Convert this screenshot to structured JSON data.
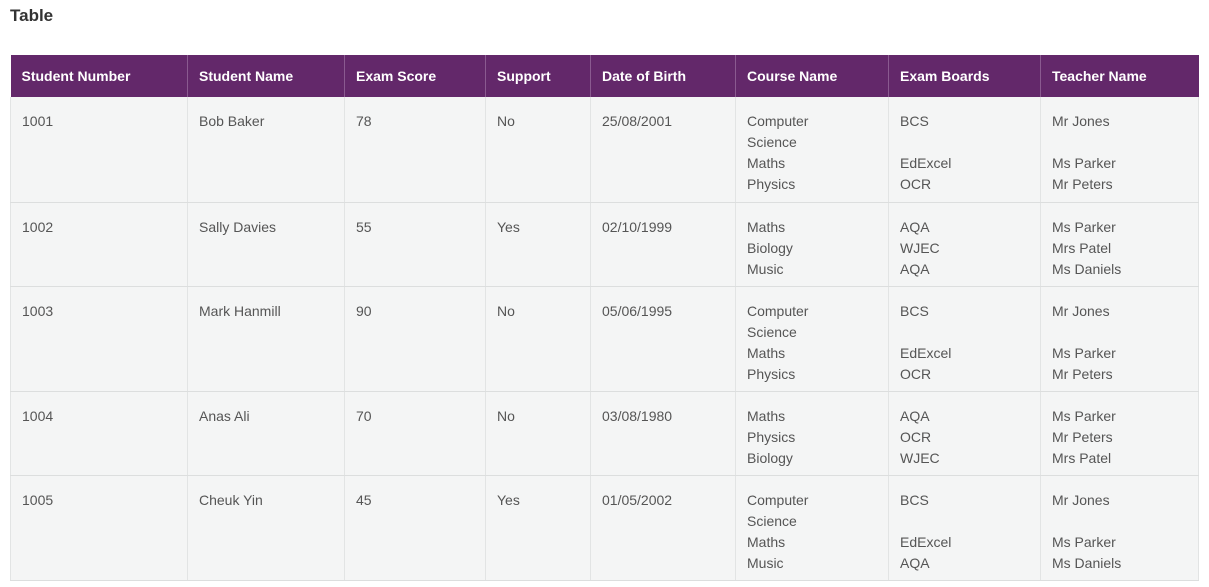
{
  "page": {
    "title": "Table"
  },
  "table": {
    "headers": [
      "Student Number",
      "Student Name",
      "Exam Score",
      "Support",
      "Date of Birth",
      "Course Name",
      "Exam Boards",
      "Teacher Name"
    ],
    "rows": [
      {
        "student_number": "1001",
        "student_name": "Bob Baker",
        "exam_score": "78",
        "support": "No",
        "date_of_birth": "25/08/2001",
        "course_lines": [
          "Computer",
          "Science",
          "Maths",
          "Physics"
        ],
        "board_lines": [
          "BCS",
          "",
          "EdExcel",
          "OCR"
        ],
        "teacher_lines": [
          "Mr Jones",
          "",
          "Ms Parker",
          "Mr Peters"
        ]
      },
      {
        "student_number": "1002",
        "student_name": "Sally Davies",
        "exam_score": "55",
        "support": "Yes",
        "date_of_birth": "02/10/1999",
        "course_lines": [
          "Maths",
          "Biology",
          "Music"
        ],
        "board_lines": [
          "AQA",
          "WJEC",
          "AQA"
        ],
        "teacher_lines": [
          "Ms Parker",
          "Mrs Patel",
          "Ms Daniels"
        ]
      },
      {
        "student_number": "1003",
        "student_name": "Mark Hanmill",
        "exam_score": "90",
        "support": "No",
        "date_of_birth": "05/06/1995",
        "course_lines": [
          "Computer",
          "Science",
          "Maths",
          "Physics"
        ],
        "board_lines": [
          "BCS",
          "",
          "EdExcel",
          "OCR"
        ],
        "teacher_lines": [
          "Mr Jones",
          "",
          "Ms Parker",
          "Mr Peters"
        ]
      },
      {
        "student_number": "1004",
        "student_name": "Anas Ali",
        "exam_score": "70",
        "support": "No",
        "date_of_birth": "03/08/1980",
        "course_lines": [
          "Maths",
          "Physics",
          "Biology"
        ],
        "board_lines": [
          "AQA",
          "OCR",
          "WJEC"
        ],
        "teacher_lines": [
          "Ms Parker",
          "Mr Peters",
          "Mrs Patel"
        ]
      },
      {
        "student_number": "1005",
        "student_name": "Cheuk Yin",
        "exam_score": "45",
        "support": "Yes",
        "date_of_birth": "01/05/2002",
        "course_lines": [
          "Computer",
          "Science",
          "Maths",
          "Music"
        ],
        "board_lines": [
          "BCS",
          "",
          "EdExcel",
          "AQA"
        ],
        "teacher_lines": [
          "Mr Jones",
          "",
          "Ms Parker",
          "Ms Daniels"
        ]
      }
    ]
  },
  "colors": {
    "header_background": "#63286a",
    "header_text": "#ffffff",
    "cell_background": "#f4f5f5",
    "cell_text": "#555555",
    "title_text": "#333333"
  }
}
